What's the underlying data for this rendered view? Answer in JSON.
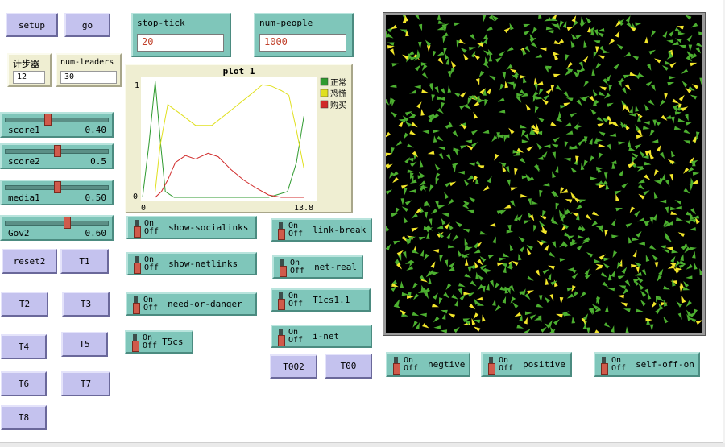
{
  "buttons": {
    "setup": "setup",
    "go": "go",
    "reset2": "reset2",
    "t1": "T1",
    "t2": "T2",
    "t3": "T3",
    "t4": "T4",
    "t5": "T5",
    "t6": "T6",
    "t7": "T7",
    "t8": "T8",
    "t002": "T002",
    "t00": "T00"
  },
  "inputs": {
    "stop_tick": {
      "label": "stop-tick",
      "value": "20"
    },
    "num_people": {
      "label": "num-people",
      "value": "1000"
    }
  },
  "monitors": {
    "steps": {
      "label": "计步器",
      "value": "12"
    },
    "num_leaders": {
      "label": "num-leaders",
      "value": "30"
    }
  },
  "sliders": {
    "score1": {
      "label": "score1",
      "value": "0.40",
      "fraction": 0.4
    },
    "score2": {
      "label": "score2",
      "value": "0.5",
      "fraction": 0.5
    },
    "media1": {
      "label": "media1",
      "value": "0.50",
      "fraction": 0.5
    },
    "gov2": {
      "label": "Gov2",
      "value": "0.60",
      "fraction": 0.6
    }
  },
  "switches": {
    "on": "On",
    "off": "Off",
    "show_socialinks": "show-socialinks",
    "show_netlinks": "show-netlinks",
    "need_or_danger": "need-or-danger",
    "t5cs": "T5cs",
    "link_break": "link-break",
    "net_real": "net-real",
    "t1cs1_1": "T1cs1.1",
    "i_net": "i-net",
    "negtive": "negtive",
    "positive": "positive",
    "self_off_on": "self-off-on"
  },
  "chart_data": {
    "type": "line",
    "title": "plot 1",
    "x_tick_labels": [
      "0",
      "13.8"
    ],
    "y_tick_labels": [
      "0",
      "1"
    ],
    "xlim": [
      0,
      13.8
    ],
    "ylim": [
      0,
      1
    ],
    "legend_position": "top-right",
    "series": [
      {
        "name": "正常",
        "color": "#2e9a2e",
        "x": [
          0,
          0.5,
          1.0,
          1.4,
          1.8,
          2.5,
          4,
          6,
          8,
          10,
          11.5,
          12.2,
          12.8
        ],
        "y": [
          0,
          0.45,
          1.0,
          0.5,
          0.05,
          0,
          0,
          0,
          0,
          0,
          0.05,
          0.3,
          0.7
        ]
      },
      {
        "name": "恐慌",
        "color": "#e0e020",
        "x": [
          1.0,
          1.4,
          2.0,
          3.0,
          4.2,
          5.5,
          7,
          8.5,
          9.5,
          10.2,
          11,
          11.6,
          12.2,
          12.8
        ],
        "y": [
          0.05,
          0.45,
          0.8,
          0.72,
          0.62,
          0.62,
          0.75,
          0.88,
          0.97,
          0.96,
          0.92,
          0.88,
          0.58,
          0.25
        ]
      },
      {
        "name": "购买",
        "color": "#d02a2a",
        "x": [
          1.0,
          1.5,
          2.0,
          2.6,
          3.4,
          4.2,
          5.2,
          6,
          7,
          8,
          9,
          10,
          11,
          12.8
        ],
        "y": [
          0,
          0.05,
          0.15,
          0.3,
          0.36,
          0.33,
          0.38,
          0.35,
          0.24,
          0.15,
          0.08,
          0.02,
          0,
          0
        ]
      }
    ]
  },
  "colors": {
    "agent_green": "#4caf30",
    "agent_yellow": "#f2e62a",
    "view_bg": "#000000"
  }
}
